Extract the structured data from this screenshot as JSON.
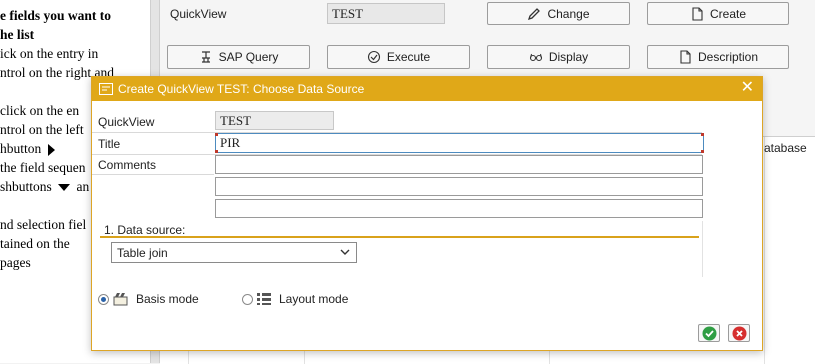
{
  "help": {
    "lines": [
      "e fields you want to",
      "he list",
      "ick on the entry in",
      "ntrol on the right and",
      "",
      " click on the en",
      "ntrol on the left",
      "hbutton",
      " the field sequen",
      "shbuttons",
      "",
      "nd selection fiel",
      "tained on the",
      "pages"
    ],
    "line_suffix_an": "an"
  },
  "background": {
    "quickview_label": "QuickView",
    "quickview_value": "TEST",
    "buttons": {
      "change": "Change",
      "create": "Create",
      "sap_query": "SAP Query",
      "execute": "Execute",
      "display": "Display",
      "description": "Description"
    },
    "table_header_fragment": "atabase"
  },
  "dialog": {
    "title": "Create QuickView TEST: Choose Data Source",
    "quickview_label": "QuickView",
    "quickview_value": "TEST",
    "title_label": "Title",
    "title_value": "PIR",
    "comments_label": "Comments",
    "comments_values": [
      "",
      "",
      ""
    ],
    "data_source_heading": "1. Data source:",
    "data_source_selected": "Table join",
    "modes": {
      "basis": "Basis mode",
      "layout": "Layout mode",
      "selected": "basis"
    }
  },
  "colors": {
    "titlebar": "#e0a818",
    "ok_green": "#2f9e44",
    "cancel_red": "#d62e2e",
    "accent_underline": "#d9a21b"
  },
  "icons": {
    "change": "pencil-icon",
    "create": "document-icon",
    "sap_query": "query-icon",
    "execute": "execute-icon",
    "display": "glasses-icon",
    "description": "document-icon",
    "title": "dialog-icon",
    "close": "close-icon",
    "ok": "checkmark-icon",
    "cancel": "cancel-icon"
  }
}
